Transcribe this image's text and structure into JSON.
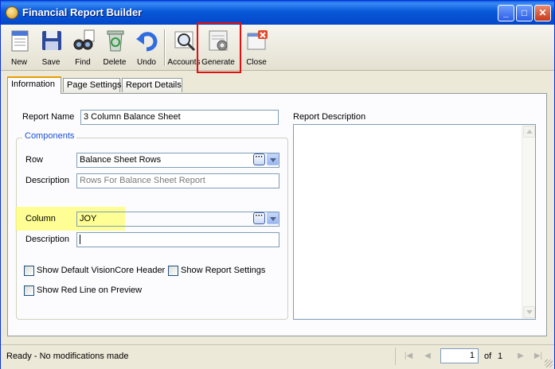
{
  "window": {
    "title": "Financial Report Builder"
  },
  "toolbar": {
    "new": "New",
    "save": "Save",
    "find": "Find",
    "delete": "Delete",
    "undo": "Undo",
    "accounts": "Accounts",
    "generate": "Generate",
    "close": "Close"
  },
  "tabs": [
    "Information",
    "Page Settings",
    "Report Details"
  ],
  "form": {
    "report_name_label": "Report Name",
    "report_name_value": "3 Column Balance Sheet",
    "components_title": "Components",
    "row_label": "Row",
    "row_value": "Balance Sheet Rows",
    "row_description_label": "Description",
    "row_description_value": "Rows For Balance Sheet Report",
    "column_label": "Column",
    "column_value": "JOY",
    "column_description_label": "Description",
    "column_description_value": "",
    "chk_header_label": "Show Default VisionCore Header",
    "chk_settings_label": "Show Report Settings",
    "chk_redline_label": "Show Red Line on Preview",
    "report_description_label": "Report Description",
    "ellipsis": "···"
  },
  "status": {
    "text": "Ready - No modifications made",
    "page": "1",
    "of_label": "of",
    "total": "1",
    "first": "|◀",
    "prev": "◀",
    "next": "▶",
    "last": "▶|"
  },
  "titlebar_buttons": {
    "minimize": "_",
    "maximize": "□",
    "close": "✕"
  },
  "colors": {
    "titlebar": "#0758d8",
    "highlight_box": "#e01010",
    "highlight_marker": "#ffff66"
  }
}
